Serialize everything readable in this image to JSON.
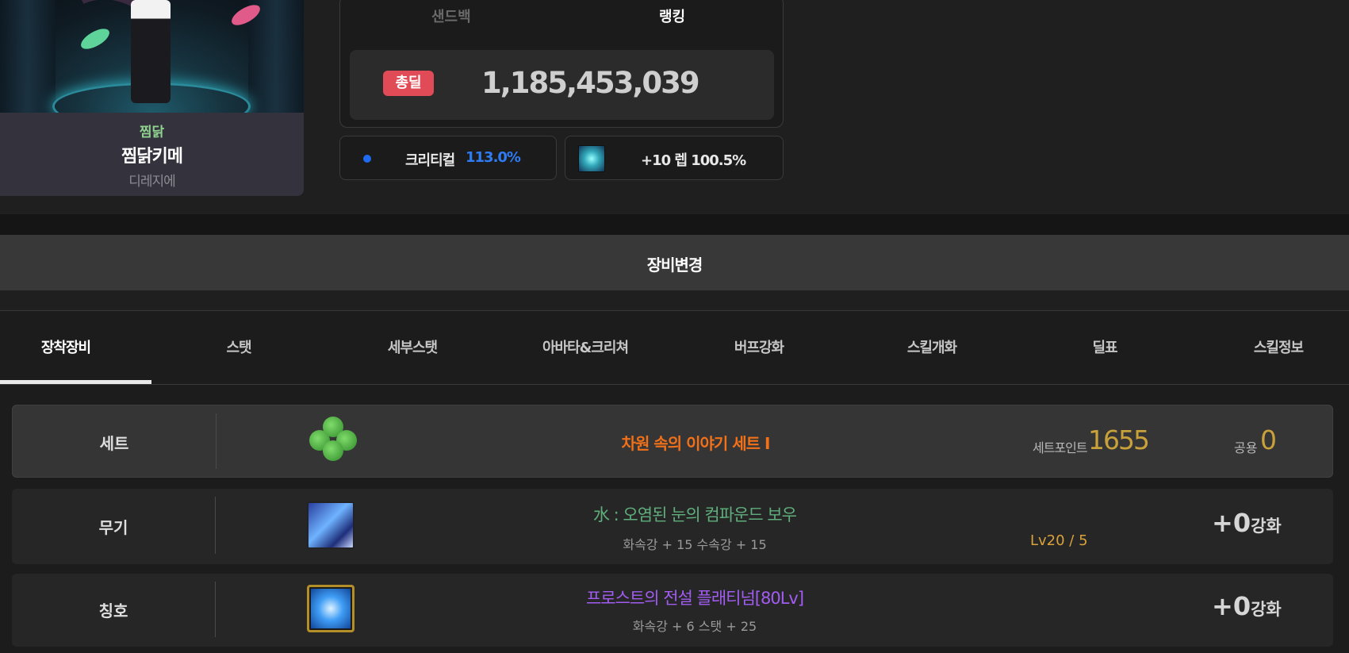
{
  "character": {
    "guild": "찜닭",
    "name": "찜닭키메",
    "class": "디레지에"
  },
  "ranking_box": {
    "tabs": [
      "샌드백",
      "랭킹"
    ],
    "active_tab": "랭킹",
    "damage_badge": "총딜",
    "damage_value": "1,185,453,039"
  },
  "stats": {
    "crit_label": "크리티컬",
    "crit_value": "113.0%",
    "crit_dot_color": "#1f6bf0",
    "level_text": "+10 렙 100.5%",
    "level_icon": "skill-crystal-icon"
  },
  "equip_bar": {
    "title": "장비변경"
  },
  "tabs": [
    "장착장비",
    "스탯",
    "세부스탯",
    "아바타&크리쳐",
    "버프강화",
    "스킬개화",
    "딜표",
    "스킬정보"
  ],
  "active_tab_index": 0,
  "rows": {
    "set": {
      "label": "세트",
      "icon": "clover-icon",
      "name": "차원 속의 이야기 세트 I",
      "point_label": "세트포인트",
      "point_value": "1655",
      "shared_label": "공용",
      "shared_value": "0"
    },
    "weapon": {
      "label": "무기",
      "icon": "weapon-compound-bow-icon",
      "name": "水 : 오염된 눈의 컴파운드 보우",
      "sub": "화속강 + 15 수속강 + 15",
      "level": "Lv20 / 5",
      "enhance_value": "+0",
      "enhance_label": "강화"
    },
    "title": {
      "label": "칭호",
      "icon": "title-gem-icon",
      "name": "프로스트의 전설 플래티넘[80Lv]",
      "sub": "화속강 + 6 스탯 + 25",
      "enhance_value": "+0",
      "enhance_label": "강화"
    }
  },
  "colors": {
    "set_name": "#f1701a",
    "weapon_name": "#5fae7c",
    "title_name": "#a25cf2",
    "points": "#c9a13a",
    "damage_badge": "#e04b57",
    "crit_value": "#2f7cf2"
  }
}
